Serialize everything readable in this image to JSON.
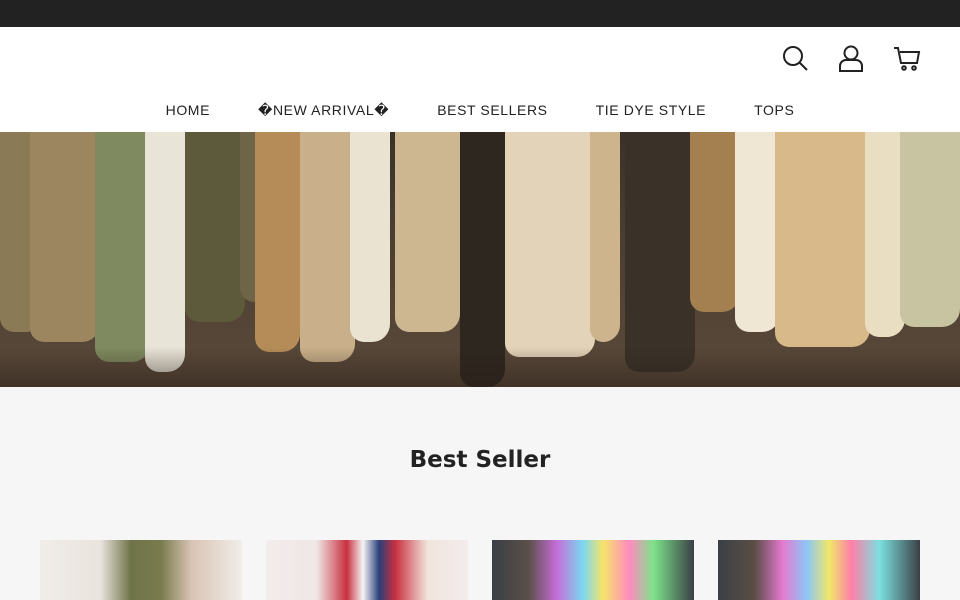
{
  "header": {
    "icons": [
      "search-icon",
      "account-icon",
      "cart-icon"
    ]
  },
  "nav": {
    "items": [
      {
        "label": "HOME"
      },
      {
        "label": "�NEW ARRIVAL�"
      },
      {
        "label": "BEST SELLERS"
      },
      {
        "label": "TIE DYE STYLE"
      },
      {
        "label": "TOPS"
      }
    ]
  },
  "best_seller": {
    "title": "Best Seller",
    "products": [
      {
        "image": "olive-cutout-top-photo"
      },
      {
        "image": "red-white-blue-print-top-photo"
      },
      {
        "image": "rainbow-tie-dye-vneck-photo"
      },
      {
        "image": "rainbow-tie-dye-laceup-photo"
      }
    ]
  },
  "colors": {
    "announce_bar": "#222222",
    "header_bg": "#ffffff",
    "page_bg": "#f6f6f6",
    "text": "#222222"
  }
}
